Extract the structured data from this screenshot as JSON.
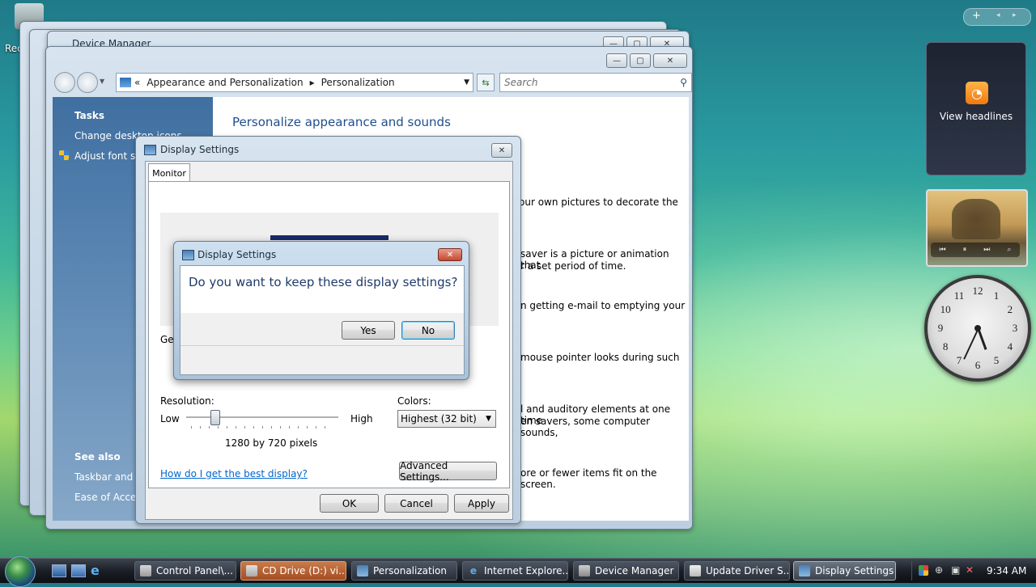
{
  "desktop": {
    "recycle_label": "Rec"
  },
  "device_manager_window": {
    "title": "Device Manager"
  },
  "personalization_window": {
    "breadcrumb_prefix": "«",
    "breadcrumb": [
      "Appearance and Personalization",
      "Personalization"
    ],
    "search_placeholder": "Search",
    "sidebar": {
      "tasks_heading": "Tasks",
      "tasks": [
        "Change desktop icons",
        "Adjust font size"
      ],
      "see_also_heading": "See also",
      "see_also": [
        "Taskbar and St",
        "Ease of Access"
      ]
    },
    "heading": "Personalize appearance and sounds",
    "snippets": [
      "our own pictures to decorate the",
      "saver is a picture or animation that",
      "r a set period of time.",
      "n getting e-mail to emptying your",
      "mouse pointer looks during such",
      "l and auditory elements at one time",
      "en savers, some computer sounds,",
      "ore or fewer items fit on the screen."
    ]
  },
  "display_settings": {
    "title": "Display Settings",
    "tab": "Monitor",
    "gen_label": "Ger",
    "resolution_label": "Resolution:",
    "low": "Low",
    "high": "High",
    "resolution_value": "1280 by 720 pixels",
    "resolution_slider_level": 0.3,
    "colors_label": "Colors:",
    "colors_value": "Highest (32 bit)",
    "help_link": "How do I get the best display?",
    "advanced_button": "Advanced Settings...",
    "ok": "OK",
    "cancel": "Cancel",
    "apply": "Apply"
  },
  "confirm_dialog": {
    "title": "Display Settings",
    "question": "Do you want to keep these display settings?",
    "yes": "Yes",
    "no": "No"
  },
  "gadgets": {
    "rss_label": "View headlines",
    "clock_numbers": [
      "12",
      "1",
      "2",
      "3",
      "4",
      "5",
      "6",
      "7",
      "8",
      "9",
      "10",
      "11"
    ]
  },
  "taskbar": {
    "tasks": [
      {
        "label": "Control Panel\\...",
        "state": "normal"
      },
      {
        "label": "CD Drive (D:) vi...",
        "state": "active"
      },
      {
        "label": "Personalization",
        "state": "normal"
      },
      {
        "label": "Internet Explore...",
        "state": "normal"
      },
      {
        "label": "Device Manager",
        "state": "normal"
      },
      {
        "label": "Update Driver S...",
        "state": "normal"
      },
      {
        "label": "Display Settings",
        "state": "current"
      }
    ],
    "clock": "9:34 AM"
  },
  "colors": {
    "accent": "#3c7fb1",
    "link": "#0066cc",
    "heading": "#1e4e8c"
  }
}
